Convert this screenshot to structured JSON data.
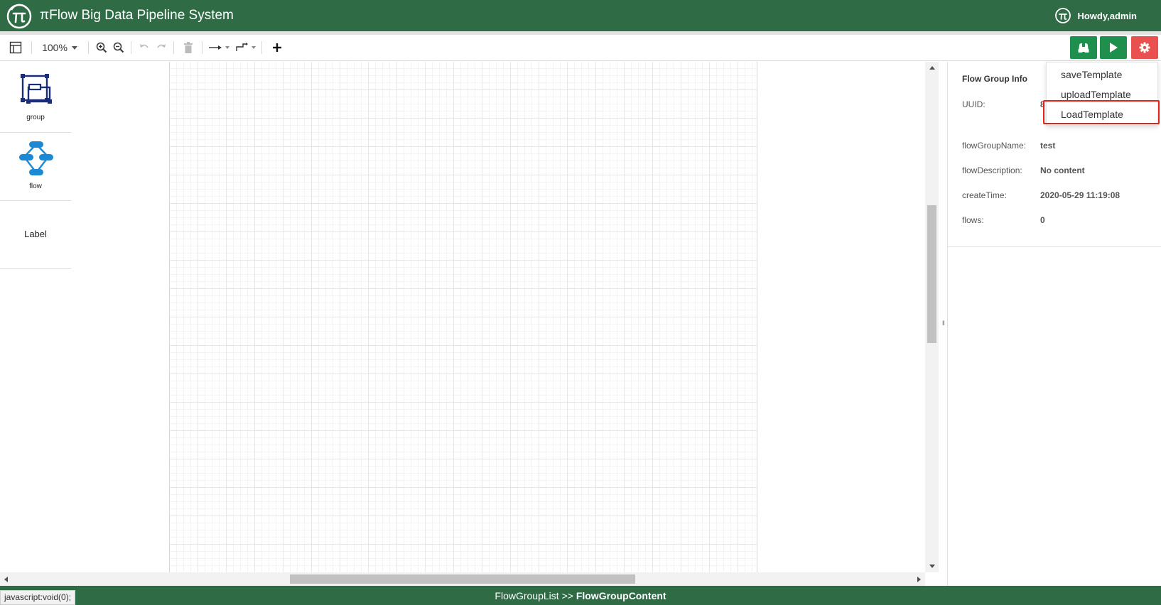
{
  "header": {
    "app_title": "πFlow Big Data Pipeline System",
    "user_greeting": "Howdy,admin",
    "brand_color": "#2f6b45"
  },
  "toolbar": {
    "zoom_value": "100%",
    "icons": [
      "format-panel-icon",
      "zoom-in-icon",
      "zoom-out-icon",
      "undo-icon",
      "redo-icon",
      "delete-icon",
      "connector-arrow-icon",
      "waypoint-icon",
      "insert-plus-icon"
    ],
    "actions": [
      {
        "name": "find-icon",
        "color": "#1f8f4d"
      },
      {
        "name": "run-icon",
        "color": "#1f8f4d"
      },
      {
        "name": "settings-icon",
        "color": "#e8514f"
      }
    ]
  },
  "palette": {
    "items": [
      {
        "caption": "group",
        "icon": "group-icon"
      },
      {
        "caption": "flow",
        "icon": "flow-icon"
      },
      {
        "caption": "Label",
        "icon": "label-text"
      }
    ]
  },
  "info_panel": {
    "title": "Flow Group Info",
    "rows": [
      {
        "key": "UUID:",
        "value": "8"
      },
      {
        "key": "flowGroupName:",
        "value": "test"
      },
      {
        "key": "flowDescription:",
        "value": "No content"
      },
      {
        "key": "createTime:",
        "value": "2020-05-29 11:19:08"
      },
      {
        "key": "flows:",
        "value": "0"
      }
    ]
  },
  "dropdown": {
    "items": [
      "saveTemplate",
      "uploadTemplate",
      "LoadTemplate"
    ],
    "highlighted": "LoadTemplate",
    "highlight_color": "#e2231a"
  },
  "footer": {
    "breadcrumb_parent": "FlowGroupList",
    "breadcrumb_separator": ">>",
    "breadcrumb_current": "FlowGroupContent"
  },
  "statusbar": {
    "text": "javascript:void(0);"
  }
}
